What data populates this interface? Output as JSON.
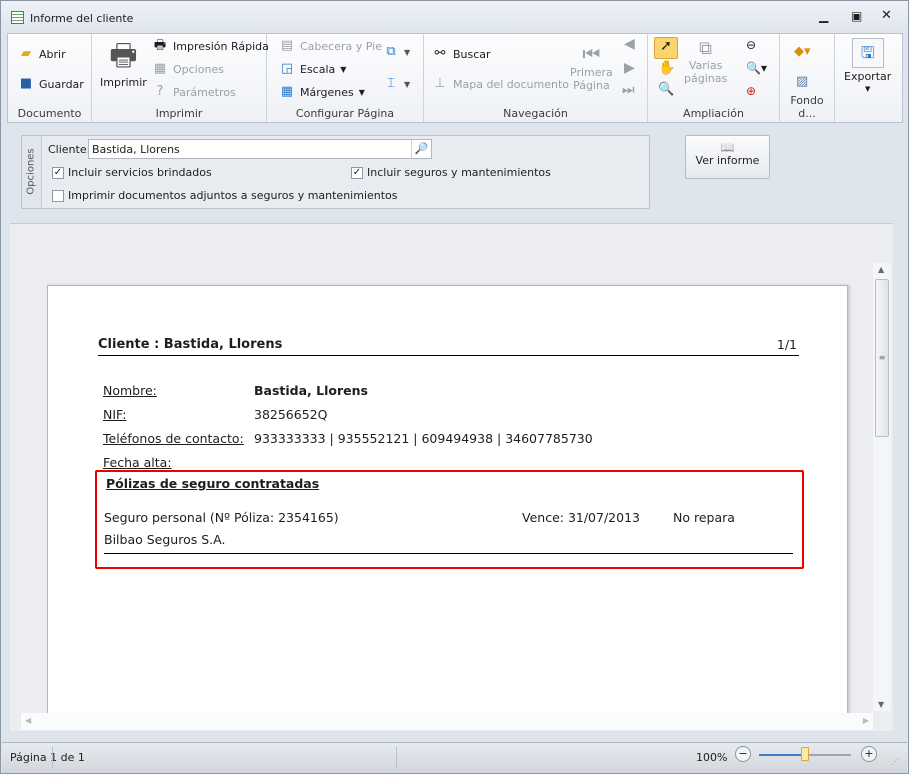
{
  "window": {
    "title": "Informe del cliente"
  },
  "ribbon": {
    "documento": {
      "label": "Documento",
      "open": "Abrir",
      "save": "Guardar"
    },
    "imprimir": {
      "label": "Imprimir",
      "print": "Imprimir",
      "quick": "Impresión Rápida",
      "options": "Opciones",
      "params": "Parámetros"
    },
    "pagina": {
      "label": "Configurar Página",
      "header": "Cabecera y Pie",
      "scale": "Escala",
      "margins": "Márgenes"
    },
    "navegacion": {
      "label": "Navegación",
      "search": "Buscar",
      "map": "Mapa del documento",
      "first1": "Primera",
      "first2": "Página"
    },
    "ampliacion": {
      "label": "Ampliación",
      "multi1": "Varias",
      "multi2": "páginas"
    },
    "fondo": {
      "label": "Fondo d..."
    },
    "exportar": {
      "label": "Exportar"
    }
  },
  "options": {
    "side_label": "Opciones",
    "client_label": "Cliente:",
    "client_value": "Bastida, Llorens",
    "cb1": {
      "label": "Incluir servicios brindados",
      "checked": true
    },
    "cb2": {
      "label": "Incluir seguros y mantenimientos",
      "checked": true
    },
    "cb3": {
      "label": "Imprimir documentos adjuntos a seguros y mantenimientos",
      "checked": false
    },
    "view_button": "Ver informe"
  },
  "report": {
    "header": "Cliente : Bastida, Llorens",
    "page": "1/1",
    "fields": [
      {
        "label": "Nombre:",
        "value": "Bastida, Llorens"
      },
      {
        "label": "NIF:",
        "value": "38256652Q"
      },
      {
        "label": "Teléfonos de contacto:",
        "value": "933333333 | 935552121 | 609494938 | 34607785730"
      },
      {
        "label": "Fecha alta:",
        "value": ""
      }
    ],
    "policies": {
      "title": "Pólizas de seguro contratadas",
      "name": "Seguro personal (Nº Póliza: 2354165)",
      "company": "Bilbao Seguros S.A.",
      "expires": "Vence: 31/07/2013",
      "repair": "No repara"
    }
  },
  "status": {
    "page": "Página 1 de 1",
    "zoom": "100%",
    "zoom_level": 0.5
  }
}
